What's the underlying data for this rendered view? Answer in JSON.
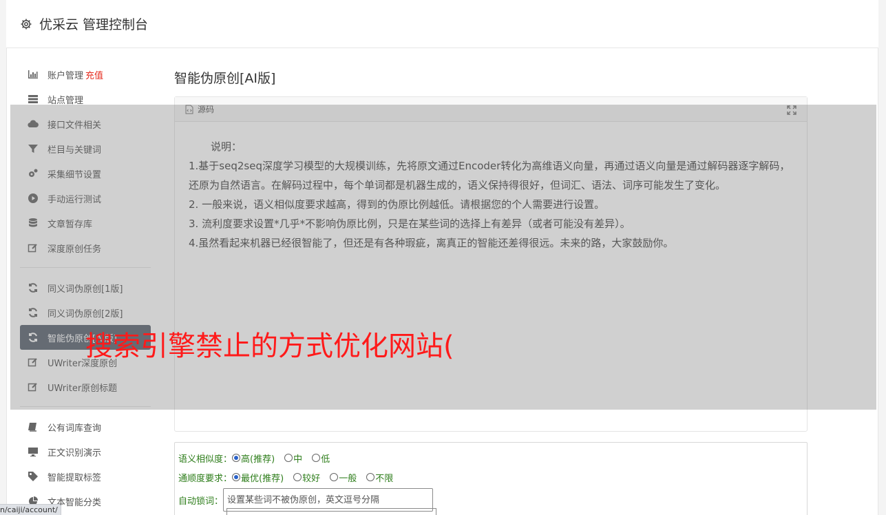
{
  "header": {
    "title": "优采云 管理控制台"
  },
  "sidebar": {
    "items": [
      {
        "label": "账户管理",
        "extra": "充值"
      },
      {
        "label": "站点管理"
      },
      {
        "label": "接口文件相关"
      },
      {
        "label": "栏目与关键词"
      },
      {
        "label": "采集细节设置"
      },
      {
        "label": "手动运行测试"
      },
      {
        "label": "文章暂存库"
      },
      {
        "label": "深度原创任务"
      }
    ],
    "items2": [
      {
        "label": "同义词伪原创[1版]"
      },
      {
        "label": "同义词伪原创[2版]"
      },
      {
        "label": "智能伪原创[AI版]"
      },
      {
        "label": "UWriter深度原创"
      },
      {
        "label": "UWriter原创标题"
      }
    ],
    "items3": [
      {
        "label": "公有词库查询"
      },
      {
        "label": "正文识别演示"
      },
      {
        "label": "智能提取标签"
      },
      {
        "label": "文本智能分类"
      }
    ]
  },
  "main": {
    "page_title": "智能伪原创[AI版]",
    "editor": {
      "tab_label": "源码",
      "intro": "说明：",
      "lines": [
        "1.基于seq2seq深度学习模型的大规模训练，先将原文通过Encoder转化为高维语义向量，再通过语义向量是通过解码器逐字解码，还原为自然语言。在解码过程中，每个单词都是机器生成的，语义保持得很好，但词汇、语法、词序可能发生了变化。",
        "2. 一般来说，语义相似度要求越高，得到的伪原比例越低。请根据您的个人需要进行设置。",
        "3. 流利度要求设置*几乎*不影响伪原比例，只是在某些词的选择上有差异（或者可能没有差异）。",
        "4.虽然看起来机器已经很智能了，但还是有各种瑕疵，离真正的智能还差得很远。未来的路，大家鼓励你。"
      ]
    },
    "options": {
      "similarity_label": "语义相似度：",
      "similarity_options": [
        "高(推荐)",
        "中",
        "低"
      ],
      "similarity_selected": "高(推荐)",
      "fluency_label": "通顺度要求：",
      "fluency_options": [
        "最优(推荐)",
        "较好",
        "一般",
        "不限"
      ],
      "fluency_selected": "最优(推荐)",
      "lock_label": "自动锁词：",
      "lock_placeholder": "设置某些词不被伪原创，英文逗号分隔"
    }
  },
  "overlay": {
    "text": "搜索引擎禁止的方式优化网站("
  },
  "status_bar": {
    "url": "n/caiji/account/"
  }
}
